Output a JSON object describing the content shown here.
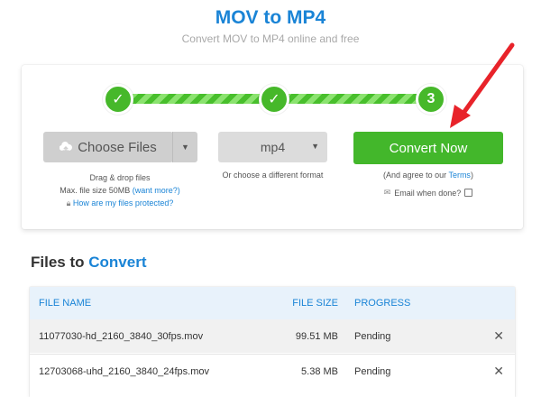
{
  "header": {
    "title": "MOV to MP4",
    "subtitle": "Convert MOV to MP4 online and free"
  },
  "steps": {
    "step1": "✓",
    "step2": "✓",
    "step3": "3"
  },
  "upload": {
    "choose_label": "Choose Files",
    "drag_text": "Drag & drop files",
    "max_size_text": "Max. file size 50MB",
    "want_more_link": "(want more?)",
    "protected_link": "How are my files protected?"
  },
  "format": {
    "selected": "mp4",
    "hint": "Or choose a different format"
  },
  "convert": {
    "label": "Convert Now",
    "agree_prefix": "(And agree to our ",
    "terms_link": "Terms",
    "agree_suffix": ")",
    "email_label": "Email when done?"
  },
  "files": {
    "heading_part1": "Files to",
    "heading_part2": "Convert",
    "columns": {
      "name": "FILE NAME",
      "size": "FILE SIZE",
      "progress": "PROGRESS"
    },
    "rows": [
      {
        "name": "11077030-hd_2160_3840_30fps.mov",
        "size": "99.51 MB",
        "progress": "Pending",
        "remove": "✕"
      },
      {
        "name": "12703068-uhd_2160_3840_24fps.mov",
        "size": "5.38 MB",
        "progress": "Pending",
        "remove": "✕"
      }
    ]
  },
  "colors": {
    "accent": "#1a84d6",
    "convert_green": "#43b72b",
    "annotation_arrow": "#e8232a"
  }
}
